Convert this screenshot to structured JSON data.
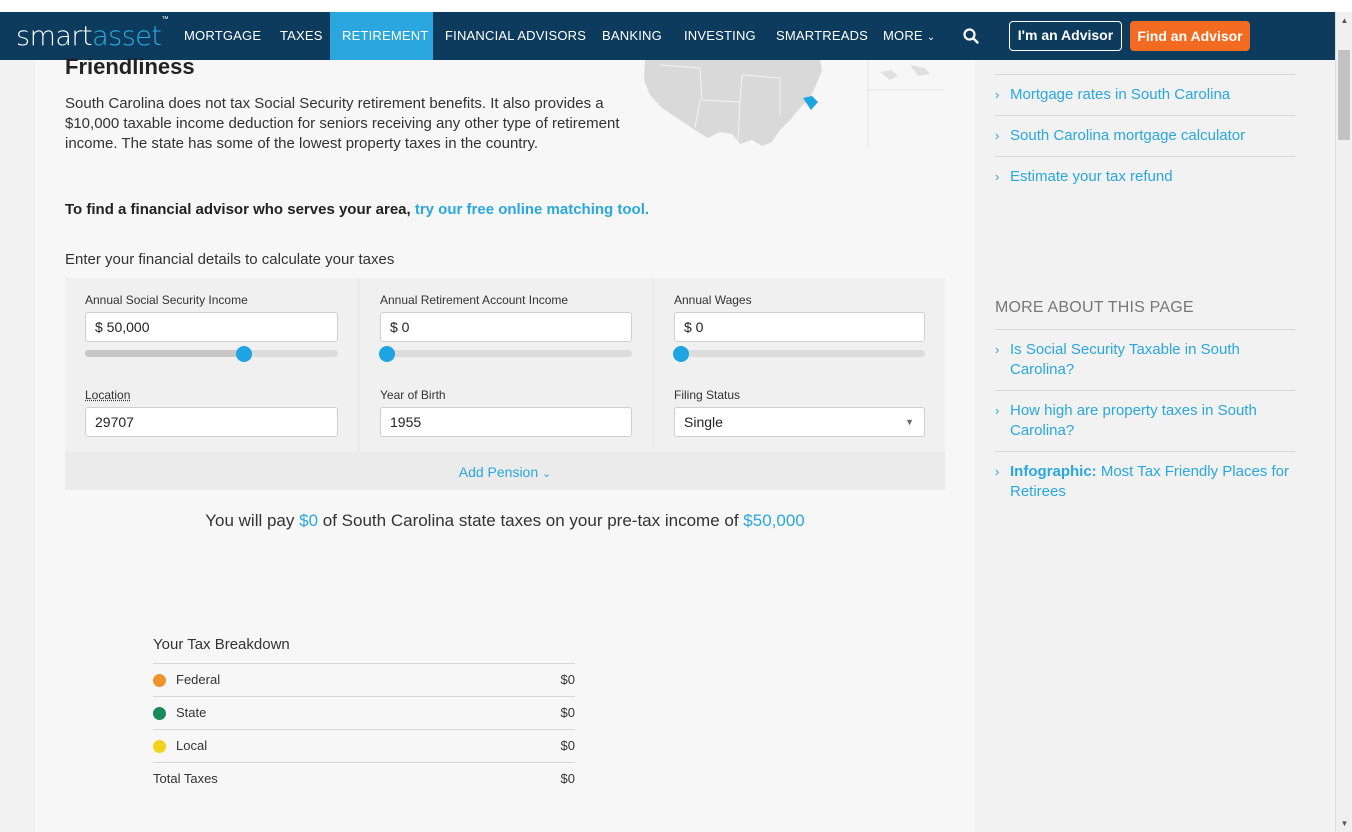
{
  "nav": {
    "logo_smart": "smart",
    "logo_asset": "asset",
    "logo_tm": "™",
    "items": [
      {
        "label": "MORTGAGE"
      },
      {
        "label": "TAXES"
      },
      {
        "label": "RETIREMENT",
        "active": true
      },
      {
        "label": "FINANCIAL ADVISORS"
      },
      {
        "label": "BANKING"
      },
      {
        "label": "INVESTING"
      },
      {
        "label": "SMARTREADS"
      },
      {
        "label": "MORE"
      }
    ],
    "advisor_button": "I'm an Advisor",
    "find_button": "Find an Advisor"
  },
  "article": {
    "heading": "Friendliness",
    "intro": "South Carolina does not tax Social Security retirement benefits. It also provides a $10,000 taxable income deduction for seniors receiving any other type of retirement income. The state has some of the lowest property taxes in the country.",
    "cta_text": "To find a financial advisor who serves your area,",
    "cta_link": "try our free online matching tool."
  },
  "calculator": {
    "label": "Enter your financial details to calculate your taxes",
    "ss_income": {
      "label": "Annual Social Security Income",
      "value": "$ 50,000",
      "slider_fraction": 0.63
    },
    "retirement_income": {
      "label": "Annual Retirement Account Income",
      "value": "$ 0",
      "slider_fraction": 0.0
    },
    "wages": {
      "label": "Annual Wages",
      "value": "$ 0",
      "slider_fraction": 0.0
    },
    "location": {
      "label": "Location",
      "value": "29707"
    },
    "birth_year": {
      "label": "Year of Birth",
      "value": "1955"
    },
    "filing_status": {
      "label": "Filing Status",
      "value": "Single"
    },
    "add_pension": "Add Pension"
  },
  "result": {
    "prefix": "You will pay",
    "amount": "$0",
    "middle": "of South Carolina state taxes on your pre-tax income of",
    "income": "$50,000"
  },
  "breakdown": {
    "title": "Your Tax Breakdown",
    "rows": [
      {
        "name": "Federal",
        "value": "$0",
        "color": "#f0932b"
      },
      {
        "name": "State",
        "value": "$0",
        "color": "#1a8a5a"
      },
      {
        "name": "Local",
        "value": "$0",
        "color": "#f2d21b"
      }
    ],
    "total_label": "Total Taxes",
    "total_value": "$0"
  },
  "sidebar": {
    "links_top": [
      {
        "label": "Mortgage rates in South Carolina"
      },
      {
        "label": "South Carolina mortgage calculator"
      },
      {
        "label": "Estimate your tax refund"
      }
    ],
    "more_heading": "MORE ABOUT THIS PAGE",
    "links_more": [
      {
        "label": "Is Social Security Taxable in South Carolina?"
      },
      {
        "label": "How high are property taxes in South Carolina?"
      },
      {
        "bold": "Infographic:",
        "label": "Most Tax Friendly Places for Retirees"
      }
    ]
  },
  "colors": {
    "nav_bg": "#0d3b5e",
    "accent": "#2aa7df",
    "find_button": "#f26b21"
  }
}
